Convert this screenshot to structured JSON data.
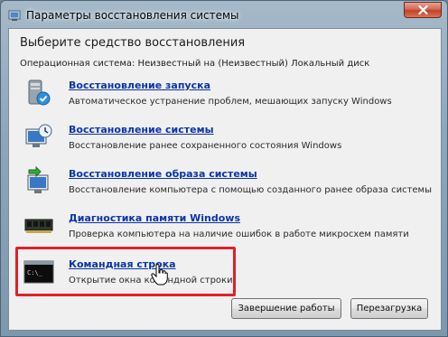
{
  "window": {
    "title": "Параметры восстановления системы",
    "close_icon": "close-icon"
  },
  "content": {
    "heading": "Выберите средство восстановления",
    "os_info": "Операционная система: Неизвестный на (Неизвестный) Локальный диск"
  },
  "tools": [
    {
      "icon": "startup-repair-icon",
      "label": "Восстановление запуска",
      "description": "Автоматическое устранение проблем, мешающих запуску Windows"
    },
    {
      "icon": "system-restore-icon",
      "label": "Восстановление системы",
      "description": "Восстановление ранее сохраненного состояния Windows"
    },
    {
      "icon": "system-image-recovery-icon",
      "label": "Восстановление образа системы",
      "description": "Восстановление компьютера с помощью  созданного ранее образа системы"
    },
    {
      "icon": "memory-diagnostic-icon",
      "label": "Диагностика памяти Windows",
      "description": "Проверка компьютера на наличие ошибок в работе микросхем памяти"
    },
    {
      "icon": "command-prompt-icon",
      "label": "Командная строка",
      "description": "Открытие окна командной строки"
    }
  ],
  "buttons": {
    "shutdown": "Завершение работы",
    "restart": "Перезагрузка"
  },
  "colors": {
    "link": "#0b35a8",
    "highlight": "#e0202a"
  }
}
